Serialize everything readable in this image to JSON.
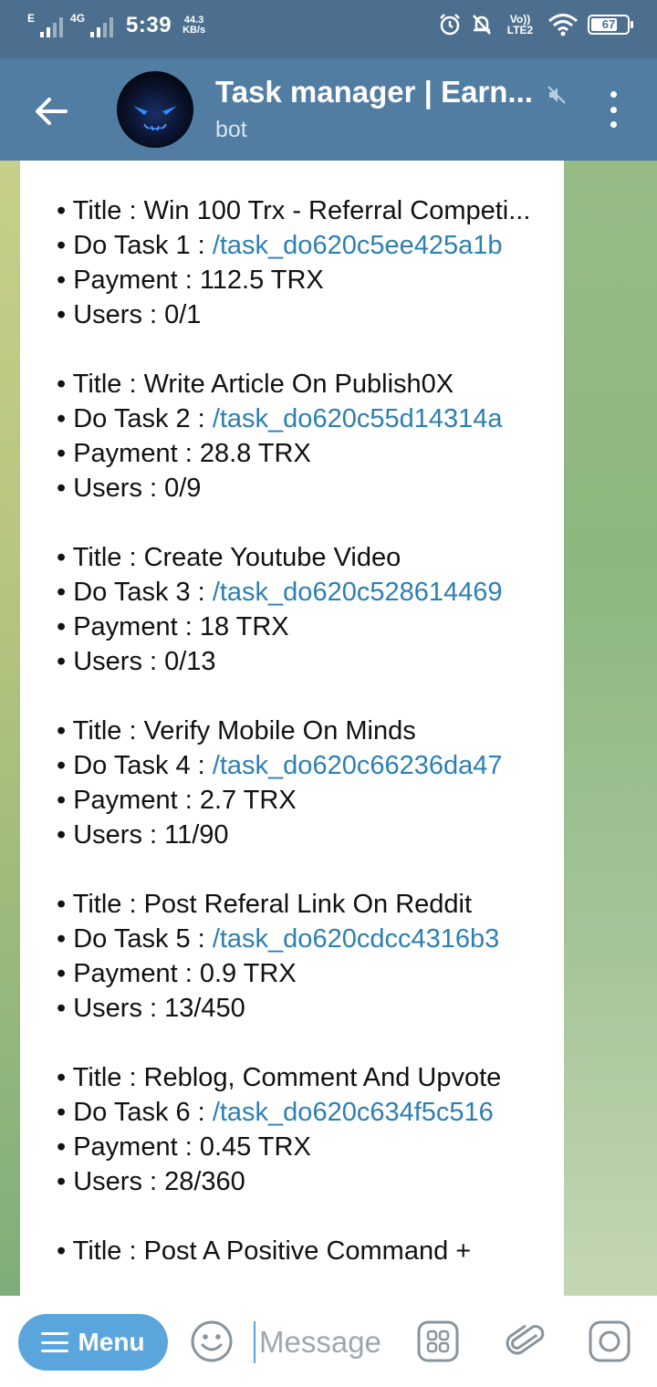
{
  "status_bar": {
    "carrier_left": "E",
    "network": "4G",
    "time": "5:39",
    "speed_value": "44.3",
    "speed_unit": "KB/s",
    "volte": "Vo)) LTE2",
    "battery": "67"
  },
  "header": {
    "title": "Task manager | Earn...",
    "subtitle": "bot"
  },
  "tasks": [
    {
      "title_label": "• Title : Win 100 Trx - Referral Competi...",
      "task_label": "• Do Task 1 : ",
      "command": "/task_do620c5ee425a1b",
      "payment": "• Payment : 112.5 TRX",
      "users": "• Users : 0/1"
    },
    {
      "title_label": "• Title : Write Article On Publish0X",
      "task_label": "• Do Task 2 : ",
      "command": "/task_do620c55d14314a",
      "payment": "• Payment : 28.8 TRX",
      "users": "• Users : 0/9"
    },
    {
      "title_label": "• Title : Create Youtube Video",
      "task_label": "• Do Task 3 : ",
      "command": "/task_do620c528614469",
      "payment": "• Payment : 18 TRX",
      "users": "• Users : 0/13"
    },
    {
      "title_label": "• Title : Verify Mobile On Minds",
      "task_label": "• Do Task 4 : ",
      "command": "/task_do620c66236da47",
      "payment": "• Payment : 2.7 TRX",
      "users": "• Users : 11/90"
    },
    {
      "title_label": "• Title : Post Referal Link On Reddit",
      "task_label": "• Do Task 5 : ",
      "command": "/task_do620cdcc4316b3",
      "payment": "• Payment : 0.9 TRX",
      "users": "• Users : 13/450"
    },
    {
      "title_label": "• Title : Reblog, Comment And Upvote",
      "task_label": "• Do Task 6 : ",
      "command": "/task_do620c634f5c516",
      "payment": "• Payment : 0.45 TRX",
      "users": "• Users : 28/360"
    }
  ],
  "partial_task_title": "• Title : Post A Positive Command +",
  "input_bar": {
    "menu_label": "Menu",
    "placeholder": "Message"
  },
  "colors": {
    "status_bar": "#4d6f8f",
    "app_bar": "#517da2",
    "link": "#2d7fb3",
    "menu_button": "#5ba5dd"
  }
}
